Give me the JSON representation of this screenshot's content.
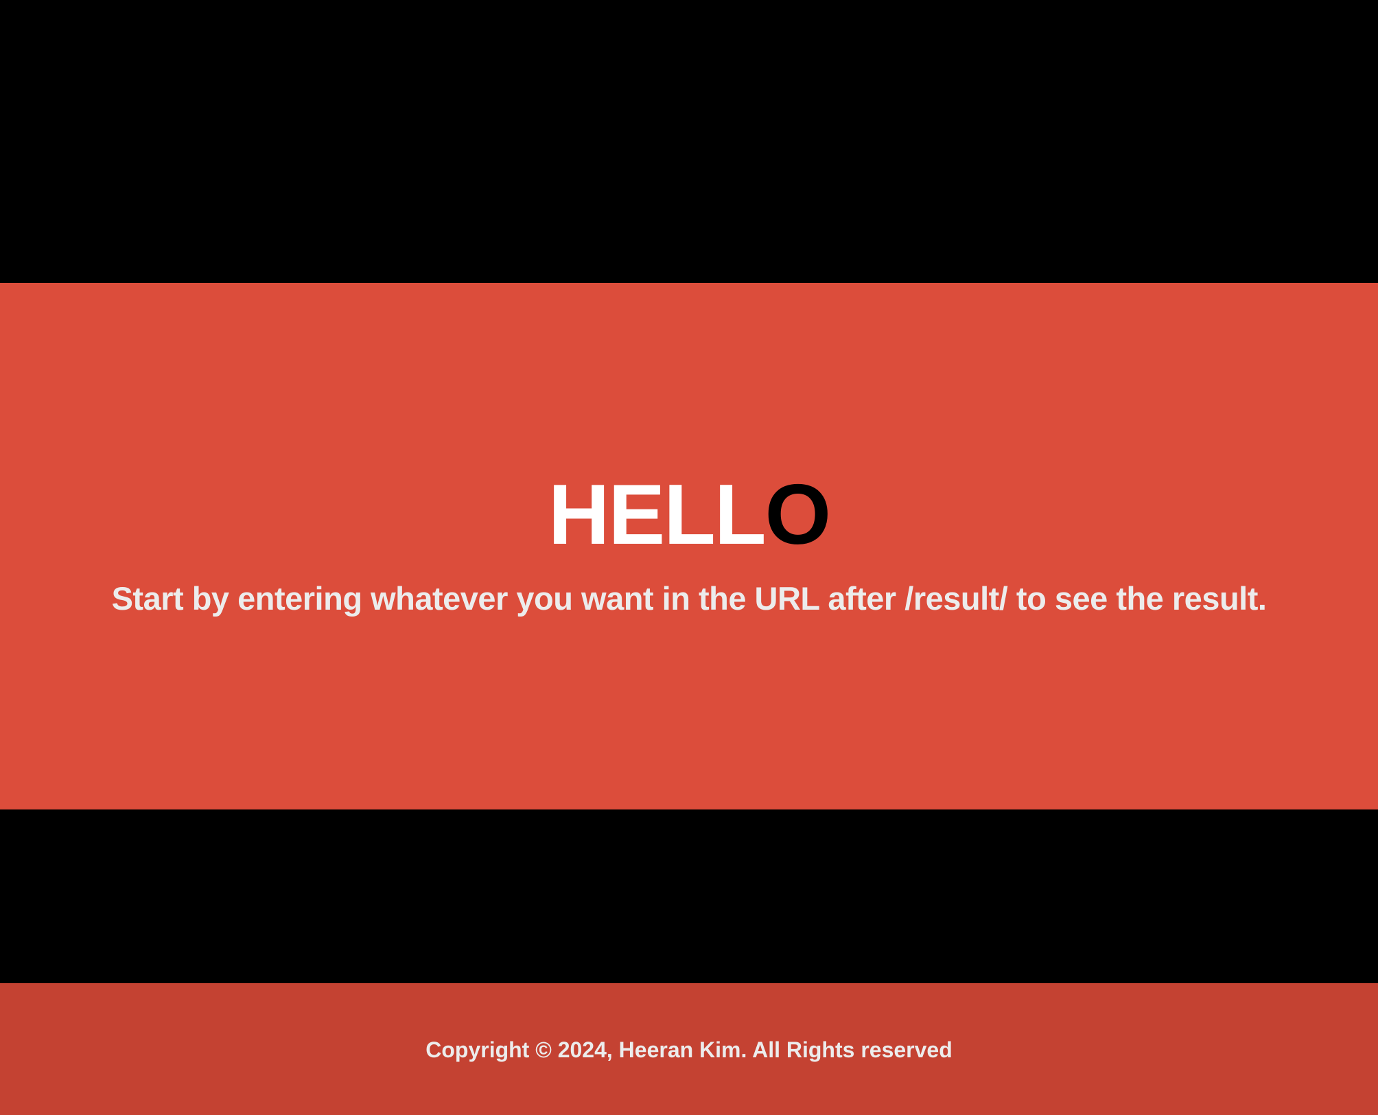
{
  "hero": {
    "title_light": "HELL",
    "title_dark": "O",
    "subtitle": "Start by entering whatever you want in the URL after /result/ to see the result."
  },
  "footer": {
    "copyright": "Copyright © 2024, Heeran Kim. All Rights reserved"
  },
  "colors": {
    "background": "#000000",
    "hero_background": "#dc4d3b",
    "footer_background": "#c44232",
    "title_light": "#ffffff",
    "title_dark": "#000000",
    "text": "#ececec"
  }
}
